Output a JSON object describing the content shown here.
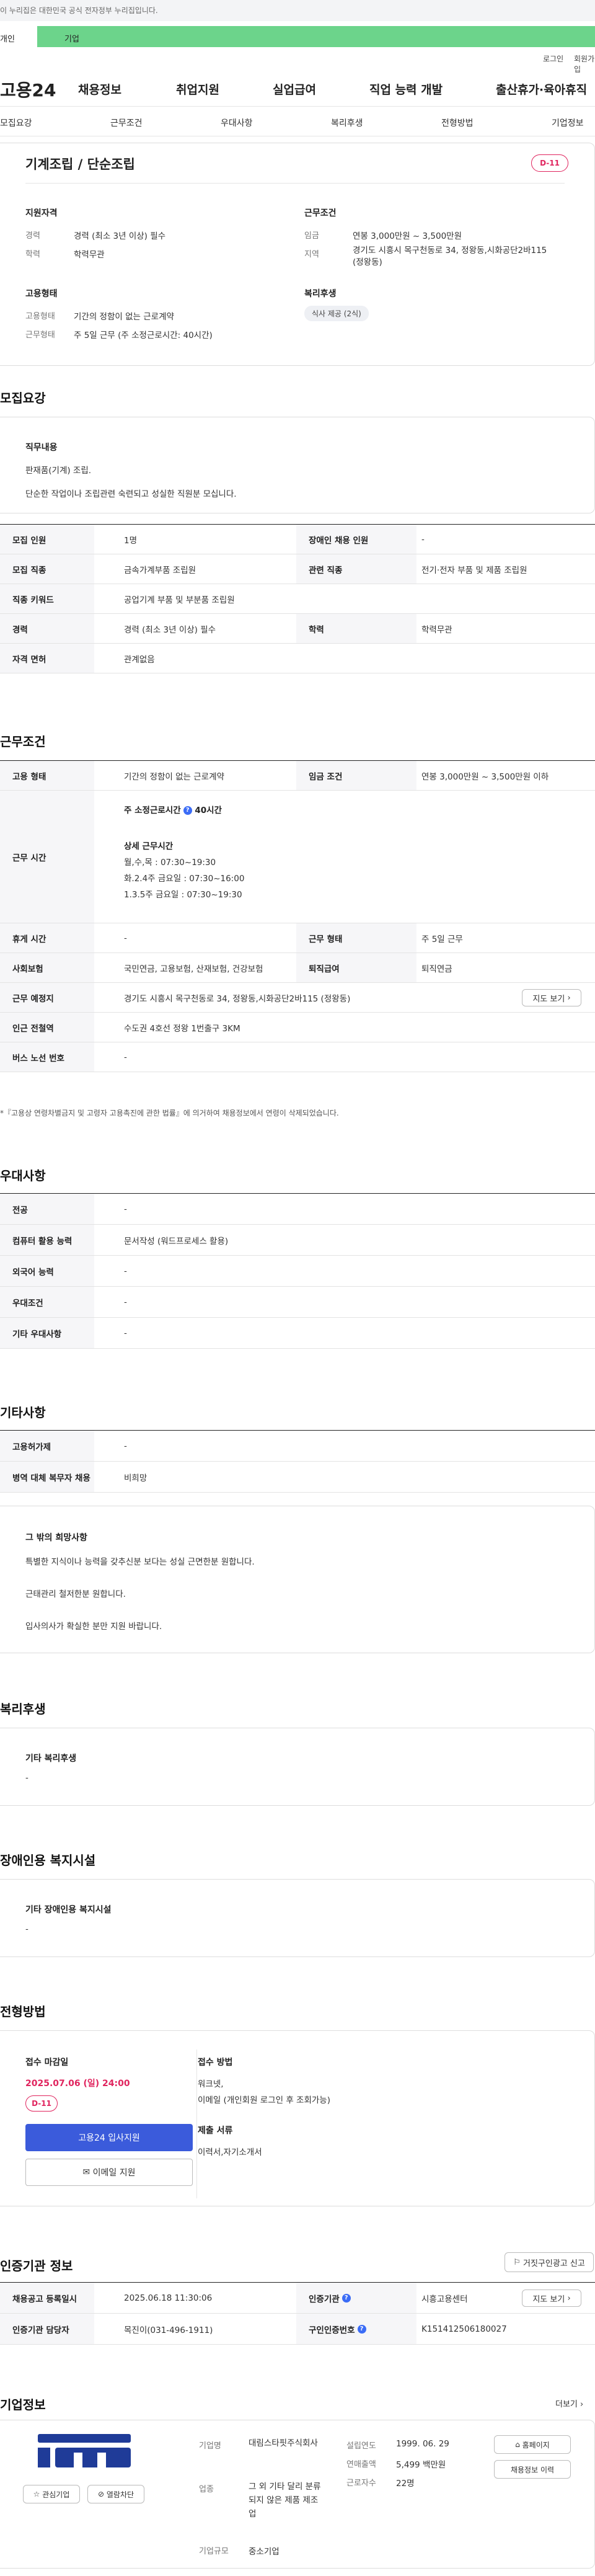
{
  "gov_banner": "이 누리집은 대한민국 공식 전자정부 누리집입니다.",
  "user_tabs": {
    "personal": "개인",
    "corporate": "기업"
  },
  "utility": {
    "login": "로그인",
    "signup": "회원가입"
  },
  "logo": "고용24",
  "gnb": [
    "채용정보",
    "취업지원",
    "실업급여",
    "직업 능력 개발",
    "출산휴가·육아휴직"
  ],
  "anchors": [
    "모집요강",
    "근무조건",
    "우대사항",
    "복리후생",
    "전형방법",
    "기업정보"
  ],
  "summary": {
    "title": "기계조립 / 단순조립",
    "dday": "D-11",
    "qual_title": "지원자격",
    "qual": [
      {
        "k": "경력",
        "v": "경력 (최소 3년 이상) 필수"
      },
      {
        "k": "학력",
        "v": "학력무관"
      }
    ],
    "cond_title": "근무조건",
    "cond": [
      {
        "k": "임금",
        "v": "연봉 3,000만원 ~ 3,500만원"
      },
      {
        "k": "지역",
        "v": "경기도 시흥시 목구천동로 34, 정왕동,시화공단2바115 (정왕동)"
      }
    ],
    "emp_title": "고용형태",
    "emp": [
      {
        "k": "고용형태",
        "v": "기간의 정함이 없는 근로계약"
      },
      {
        "k": "근무형태",
        "v": "주 5일 근무 (주 소정근로시간: 40시간)"
      }
    ],
    "welfare_title": "복리후생",
    "welfare_tag": "식사 제공 (2식)"
  },
  "recruit": {
    "section_title": "모집요강",
    "duty_title": "직무내용",
    "duty_lines": [
      "판재품(기계) 조립.",
      "단순한 작업이나 조립관련 숙련되고 성실한 직원분 모십니다."
    ],
    "rows": [
      [
        "모집 인원",
        "1명",
        "장애인 채용 인원",
        "-"
      ],
      [
        "모집 직종",
        "금속가계부품 조립원",
        "관련 직종",
        "전기·전자 부품 및 제품 조립원"
      ],
      [
        "직종 키워드",
        "공업기계 부품 및 부분품 조립원"
      ],
      [
        "경력",
        "경력 (최소 3년 이상) 필수",
        "학력",
        "학력무관"
      ],
      [
        "자격 면허",
        "관계없음"
      ]
    ]
  },
  "work": {
    "section_title": "근무조건",
    "emp_type_k": "고용 형태",
    "emp_type_v": "기간의 정함이 없는 근로계약",
    "wage_k": "임금 조건",
    "wage_v": "연봉 3,000만원 ~ 3,500만원 이하",
    "hours_k": "근무 시간",
    "hours_weekly": "주 소정근로시간",
    "hours_weekly_v": "40시간",
    "hours_detail_title": "상세 근무시간",
    "hours_detail": [
      "월,수,목 : 07:30~19:30",
      "화.2.4주 금요일 : 07:30~16:00",
      "1.3.5주 금요일 : 07:30~19:30"
    ],
    "rest_k": "휴게 시간",
    "rest_v": "-",
    "shape_k": "근무 형태",
    "shape_v": "주 5일 근무",
    "ins_k": "사회보험",
    "ins_v": "국민연금, 고용보험, 산재보험, 건강보험",
    "sev_k": "퇴직급여",
    "sev_v": "퇴직연금",
    "loc_k": "근무 예정지",
    "loc_v": "경기도 시흥시 목구천동로 34, 정왕동,시화공단2바115 (정왕동)",
    "map_btn": "지도 보기",
    "subway_k": "인근 전철역",
    "subway_v": "수도권 4호선 정왕 1번출구 3KM",
    "bus_k": "버스 노선 번호",
    "bus_v": "-",
    "note": "*『고용상 연령차별금지 및 고령자 고용촉진에 관한 법률』에 의거하여 채용정보에서 연령이 삭제되었습니다."
  },
  "pref": {
    "section_title": "우대사항",
    "rows": [
      [
        "전공",
        "-"
      ],
      [
        "컴퓨터 활용 능력",
        "문서작성 (워드프로세스 활용)"
      ],
      [
        "외국어 능력",
        "-"
      ],
      [
        "우대조건",
        "-"
      ],
      [
        "기타 우대사항",
        "-"
      ]
    ]
  },
  "etc": {
    "section_title": "기타사항",
    "rows": [
      [
        "고용허가제",
        "-"
      ],
      [
        "병역 대체 복무자 채용",
        "비희망"
      ]
    ],
    "other_title": "그 밖의 희망사항",
    "other_lines": [
      "특별한 지식이나 능력을 갖추신분 보다는 성실 근면한분 원합니다.",
      "근태관리 철저한분 원합니다.",
      "입사의사가 확실한 분만 지원 바랍니다."
    ]
  },
  "welfare": {
    "section_title": "복리후생",
    "box_title": "기타 복리후생",
    "box_value": "-"
  },
  "disability": {
    "section_title": "장애인용 복지시설",
    "box_title": "기타 장애인용 복지시설",
    "box_value": "-"
  },
  "process": {
    "section_title": "전형방법",
    "deadline_title": "접수 마감일",
    "deadline": "2025.07.06 (일) 24:00",
    "dday": "D-11",
    "apply_btn": "고용24 입사지원",
    "email_btn": "이메일 지원",
    "method_title": "접수 방법",
    "method_lines": [
      "워크넷,",
      "이메일 (개인회원 로그인 후 조회가능)"
    ],
    "docs_title": "제출 서류",
    "docs": "이력서,자기소개서"
  },
  "cert": {
    "section_title": "인증기관 정보",
    "report_btn": "거짓구인광고 신고",
    "rows": [
      [
        "채용공고 등록일시",
        "2025.06.18 11:30:06",
        "인증기관",
        "시흥고용센터"
      ],
      [
        "인증기관 담당자",
        "목진이(031-496-1911)",
        "구인인증번호",
        "K151412506180027"
      ]
    ],
    "map_btn": "지도 보기"
  },
  "company": {
    "section_title": "기업정보",
    "more": "더보기",
    "interest_btn": "관심기업",
    "block_btn": "열람차단",
    "name_k": "기업명",
    "name_v": "대림스타핏주식회사",
    "industry_k": "업종",
    "industry_v": "그 외 기타 달리 분류되지 않은 제품 제조업",
    "size_k": "기업규모",
    "size_v": "중소기업",
    "founded_k": "설립연도",
    "founded_v": "1999. 06. 29",
    "sales_k": "연매출액",
    "sales_v": "5,499 백만원",
    "emp_k": "근로자수",
    "emp_v": "22명",
    "home_btn": "홈페이지",
    "jobs_btn": "채용정보 이력"
  },
  "colors": {
    "accent": "#3b5bdb",
    "green": "#6cd48b",
    "dday": "#e0245e"
  }
}
